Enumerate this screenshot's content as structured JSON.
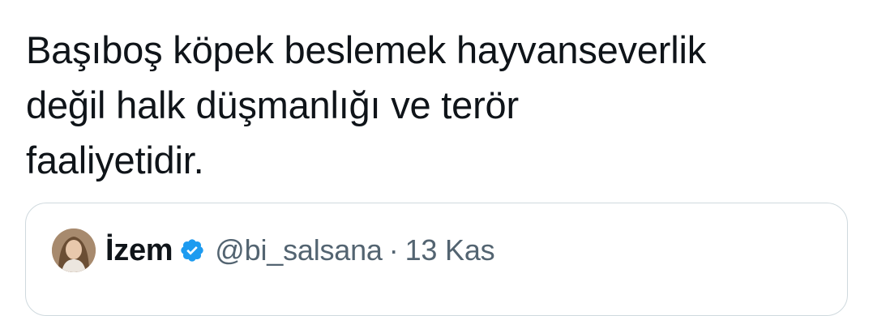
{
  "tweet": {
    "text": "Başıboş köpek beslemek hayvanseverlik\ndeğil halk düşmanlığı ve terör\nfaaliyetidir."
  },
  "quoted_tweet": {
    "display_name": "İzem",
    "verified": true,
    "handle": "@bi_salsana",
    "separator": "·",
    "date": "13 Kas"
  },
  "colors": {
    "text_primary": "#0f1419",
    "text_secondary": "#536471",
    "card_border": "#cfd9de",
    "verified_badge": "#1d9bf0"
  },
  "icons": {
    "verified": "verified-badge-icon",
    "avatar": "user-avatar"
  }
}
